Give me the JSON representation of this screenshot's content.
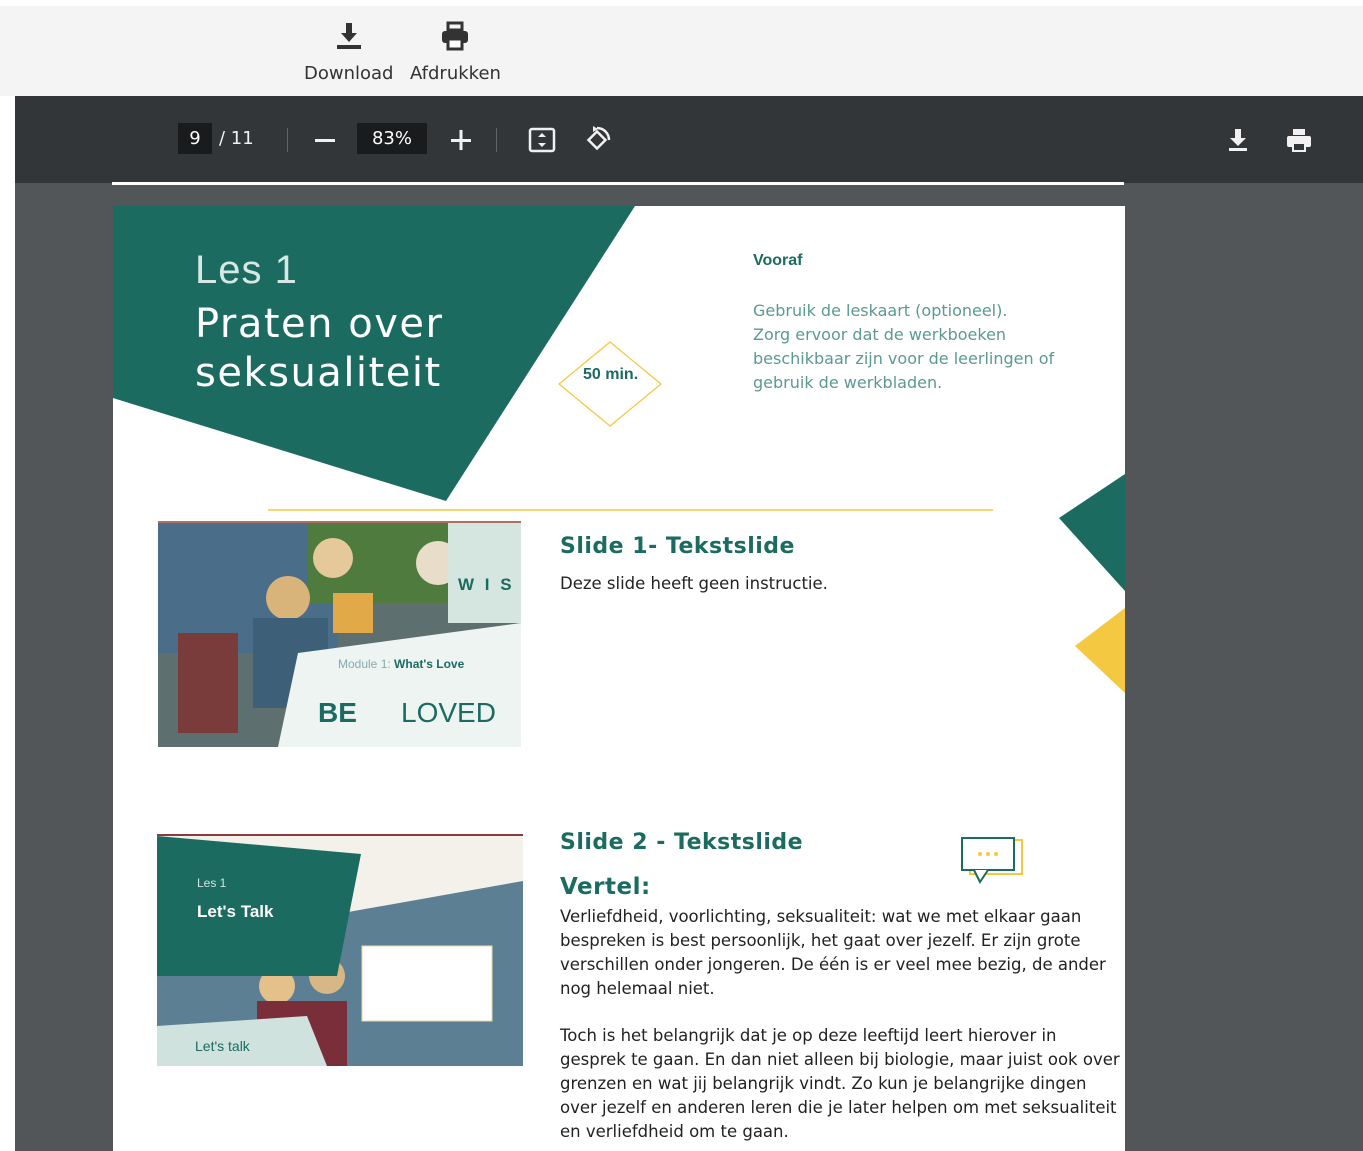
{
  "topbar": {
    "download_label": "Download",
    "print_label": "Afdrukken"
  },
  "viewer": {
    "current_page": "9",
    "total_pages": "/ 11",
    "zoom": "83%",
    "icons": [
      "minus-icon",
      "plus-icon",
      "fit-page-icon",
      "rotate-icon",
      "download-icon",
      "print-icon",
      "more-icon"
    ]
  },
  "page": {
    "lesson_label": "Les 1",
    "lesson_title_line1": "Praten over",
    "lesson_title_line2": "seksualiteit",
    "duration": "50 min.",
    "vooraf_heading": "Vooraf",
    "vooraf_lines": [
      "Gebruik de leskaart (optioneel).",
      "Zorg ervoor dat de werkboeken",
      "beschikbaar zijn voor de leerlingen of",
      "gebruik de werkbladen."
    ],
    "slide1": {
      "heading": "Slide 1- Tekstslide",
      "text": "Deze slide heeft geen instructie.",
      "thumb_logo": "W I S",
      "thumb_module": "Module 1:",
      "thumb_module_name": "What's Love",
      "thumb_be": "BE",
      "thumb_loved": "LOVED"
    },
    "slide2": {
      "heading": "Slide 2 - Tekstslide",
      "vertel_label": "Vertel:",
      "para1": [
        "Verliefdheid, voorlichting, seksualiteit: wat we met elkaar gaan",
        "bespreken is best persoonlijk, het gaat over jezelf. Er zijn grote",
        "verschillen onder jongeren. De één is er veel mee bezig, de ander",
        "nog helemaal niet."
      ],
      "para2": [
        "Toch is het belangrijk dat je op deze leeftijd leert hierover in",
        "gesprek te gaan. En dan niet alleen bij biologie, maar juist ook over",
        "grenzen en wat jij belangrijk vindt. Zo kun je belangrijke dingen",
        "over jezelf en anderen leren die je later helpen om met seksualiteit",
        "en verliefdheid om te gaan."
      ],
      "thumb_les": "Les 1",
      "thumb_title": "Let's Talk",
      "thumb_footer": "Let's talk"
    }
  },
  "colors": {
    "teal": "#1b6b61",
    "yellow": "#f5c842",
    "viewer_bg": "#525659",
    "toolbar_bg": "#323639"
  }
}
